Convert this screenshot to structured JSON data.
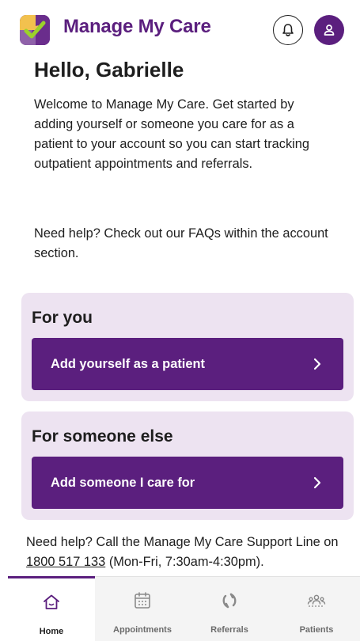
{
  "header": {
    "app_title": "Manage My Care",
    "logo_icon": "puzzle-check-logo",
    "notifications_icon": "bell-icon",
    "account_icon": "user-icon"
  },
  "main": {
    "greeting": "Hello, Gabrielle",
    "intro": "Welcome to Manage My Care. Get started by adding yourself or someone you care for as a patient to your account so you can start tracking outpatient appointments and referrals.",
    "help_faq": "Need help? Check out our FAQs within the account section."
  },
  "cards": {
    "for_you": {
      "title": "For you",
      "button_label": "Add yourself as a patient"
    },
    "for_someone_else": {
      "title": "For someone else",
      "button_label": "Add someone I care for"
    }
  },
  "support": {
    "prefix": "Need help? Call the Manage My Care Support Line on ",
    "phone": "1800 517 133",
    "suffix": " (Mon-Fri, 7:30am-4:30pm)."
  },
  "tabbar": {
    "active": "Home",
    "tabs": [
      {
        "label": "Home",
        "icon": "home-icon"
      },
      {
        "label": "Appointments",
        "icon": "calendar-icon"
      },
      {
        "label": "Referrals",
        "icon": "refresh-arrows-icon"
      },
      {
        "label": "Patients",
        "icon": "people-icon"
      }
    ]
  },
  "colors": {
    "brand_purple": "#5b1f7e",
    "card_background": "#ede3f1",
    "logo_yellow": "#f2c14e",
    "logo_green": "#9bd12a"
  }
}
